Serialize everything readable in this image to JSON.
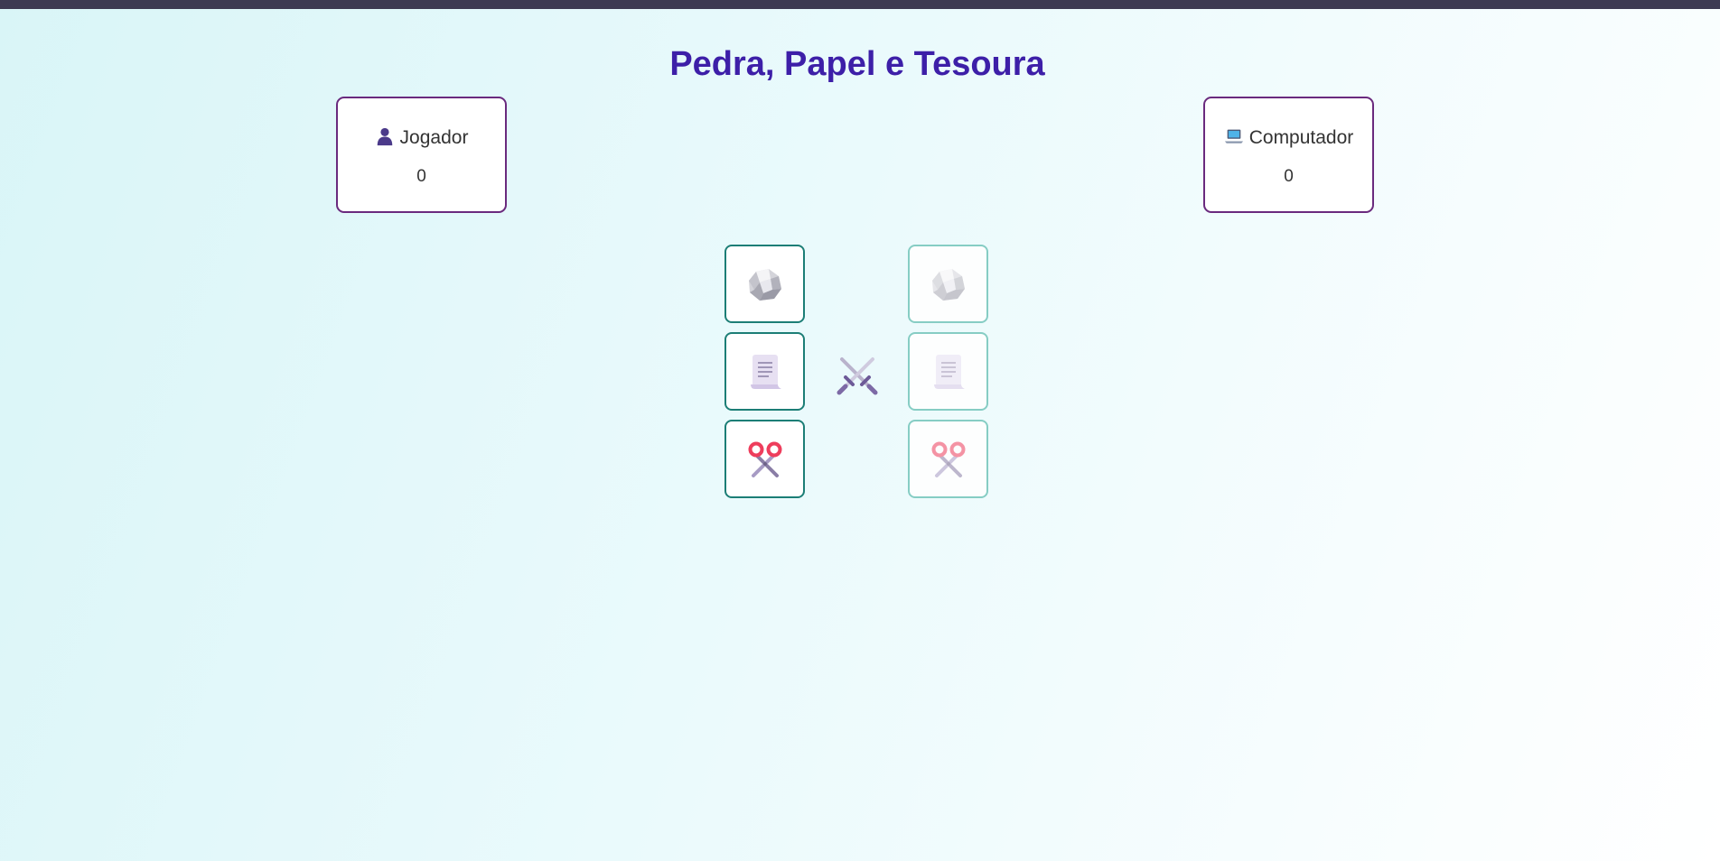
{
  "game": {
    "title": "Pedra, Papel e Tesoura"
  },
  "scoreboard": {
    "player": {
      "label": "Jogador",
      "score": "0",
      "icon": "person-silhouette-icon"
    },
    "computer": {
      "label": "Computador",
      "score": "0",
      "icon": "laptop-icon"
    }
  },
  "choices": {
    "player": [
      {
        "name": "pedra",
        "icon": "rock-icon"
      },
      {
        "name": "papel",
        "icon": "paper-scroll-icon"
      },
      {
        "name": "tesoura",
        "icon": "scissors-icon"
      }
    ],
    "computer": [
      {
        "name": "pedra",
        "icon": "rock-icon"
      },
      {
        "name": "papel",
        "icon": "paper-scroll-icon"
      },
      {
        "name": "tesoura",
        "icon": "scissors-icon"
      }
    ]
  },
  "versus_icon": "crossed-swords-icon",
  "colors": {
    "title": "#3d1fa8",
    "score_border": "#6a2a7e",
    "choice_border": "#1c7e76",
    "choice_border_computer": "#86cdc4",
    "top_strip": "#3d3a52"
  }
}
